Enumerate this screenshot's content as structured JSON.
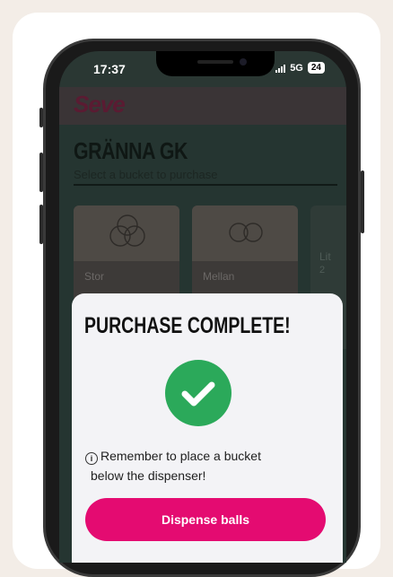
{
  "status_bar": {
    "time": "17:37",
    "network": "5G",
    "battery": "24"
  },
  "app": {
    "logo": "Seve",
    "club_name": "GRÄNNA GK",
    "subtitle": "Select a bucket to purchase",
    "buckets": [
      {
        "name": "Stor"
      },
      {
        "name": "Mellan"
      },
      {
        "name": "Lit",
        "price": "2"
      }
    ]
  },
  "modal": {
    "title": "PURCHASE COMPLETE!",
    "note_line1": "Remember to place a bucket",
    "note_line2": "below the dispenser!",
    "button_label": "Dispense balls"
  },
  "colors": {
    "accent": "#e40b71",
    "success": "#2ba95a",
    "background": "#f3ede7"
  }
}
